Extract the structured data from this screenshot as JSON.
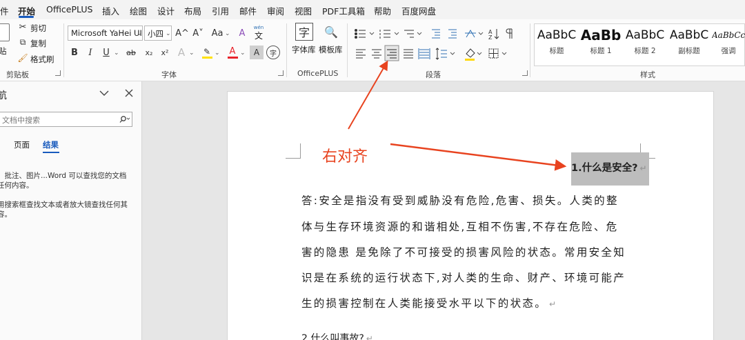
{
  "menu": {
    "items": [
      "件",
      "开始",
      "OfficePLUS",
      "插入",
      "绘图",
      "设计",
      "布局",
      "引用",
      "邮件",
      "审阅",
      "视图",
      "PDF工具箱",
      "帮助",
      "百度网盘"
    ],
    "active": "开始"
  },
  "ribbon": {
    "clipboard": {
      "cut": "剪切",
      "copy": "复制",
      "format_painter": "格式刷",
      "paste_partial": "贴",
      "label": "剪贴板"
    },
    "font": {
      "name": "Microsoft YaHei UI",
      "size": "小四",
      "grow": "A^",
      "shrink": "A˅",
      "case": "Aa",
      "clear": "A",
      "phonetic_top": "wén",
      "phonetic_bottom": "文",
      "bold": "B",
      "italic": "I",
      "underline": "U",
      "strike": "ab",
      "subscript": "x₂",
      "superscript": "x²",
      "text_effects": "A",
      "highlight": "✎",
      "font_color": "A",
      "char_shading": "A",
      "enclose": "字",
      "label": "字体",
      "font_color_hex": "#e8222a",
      "highlight_hex": "#ffe100"
    },
    "officeplus": {
      "zi_icon": "字",
      "font_library": "字体库",
      "template_library": "模板库",
      "label": "OfficePLUS"
    },
    "paragraph": {
      "label": "段落",
      "shading_hex": "#ffd700"
    },
    "styles": {
      "label": "样式",
      "items": [
        {
          "sample": "AaBbC",
          "name": "标题"
        },
        {
          "sample": "AaBb",
          "name": "标题 1"
        },
        {
          "sample": "AaBbC",
          "name": "标题 2"
        },
        {
          "sample": "AaBbC",
          "name": "副标题"
        },
        {
          "sample": "AaBbCcI",
          "name": "强调"
        }
      ]
    }
  },
  "nav": {
    "title_partial": "航",
    "search_placeholder": "文档中搜索",
    "tabs": [
      "页面",
      "结果"
    ],
    "active_tab": "结果",
    "msg1": [
      "、批注、图片...Word 可以查找您的文档",
      "任何内容。"
    ],
    "msg2": [
      "用搜索框查找文本或者放大镜查找任何其",
      "容。"
    ]
  },
  "document": {
    "heading1": "1.什么是安全?",
    "paragraph": [
      "答:安全是指没有受到威胁没有危险,危害、损失。人类的整",
      "体与生存环境资源的和谐相处,互相不伤害,不存在危险、危",
      "害的隐患 是免除了不可接受的损害风险的状态。常用安全知",
      "识是在系统的运行状态下,对人类的生命、财产、环境可能产",
      "生的损害控制在人类能接受水平以下的状态。"
    ],
    "heading2": "2.什么叫事故?",
    "pilcrow": "↵"
  },
  "annotation": {
    "label": "右对齐",
    "color": "#e8431f"
  }
}
